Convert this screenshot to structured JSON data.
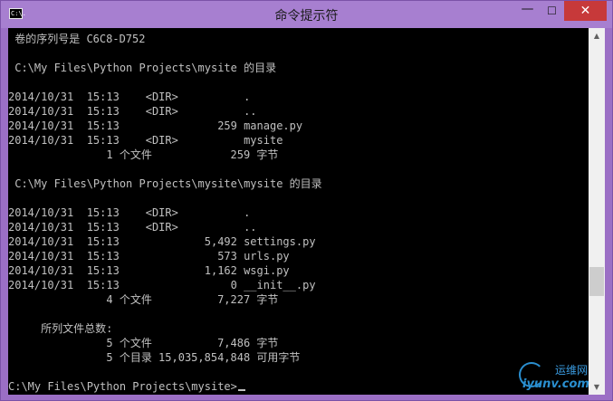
{
  "window": {
    "title": "命令提示符",
    "icon_label": "C:\\.",
    "controls": {
      "minimize": "—",
      "maximize": "☐",
      "close": "✕"
    }
  },
  "console": {
    "lines": [
      " 卷的序列号是 C6C8-D752",
      "",
      " C:\\My Files\\Python Projects\\mysite 的目录",
      "",
      "2014/10/31  15:13    <DIR>          .",
      "2014/10/31  15:13    <DIR>          ..",
      "2014/10/31  15:13               259 manage.py",
      "2014/10/31  15:13    <DIR>          mysite",
      "               1 个文件            259 字节",
      "",
      " C:\\My Files\\Python Projects\\mysite\\mysite 的目录",
      "",
      "2014/10/31  15:13    <DIR>          .",
      "2014/10/31  15:13    <DIR>          ..",
      "2014/10/31  15:13             5,492 settings.py",
      "2014/10/31  15:13               573 urls.py",
      "2014/10/31  15:13             1,162 wsgi.py",
      "2014/10/31  15:13                 0 __init__.py",
      "               4 个文件          7,227 字节",
      "",
      "     所列文件总数:",
      "               5 个文件          7,486 字节",
      "               5 个目录 15,035,854,848 可用字节",
      "",
      "C:\\My Files\\Python Projects\\mysite>"
    ]
  },
  "watermark": {
    "cn": "运维网",
    "url": "iyunv.com"
  },
  "colors": {
    "console_bg": "#000000",
    "console_text": "#c0c0c0",
    "titlebar": "#a77fd0",
    "close": "#c7393a"
  }
}
